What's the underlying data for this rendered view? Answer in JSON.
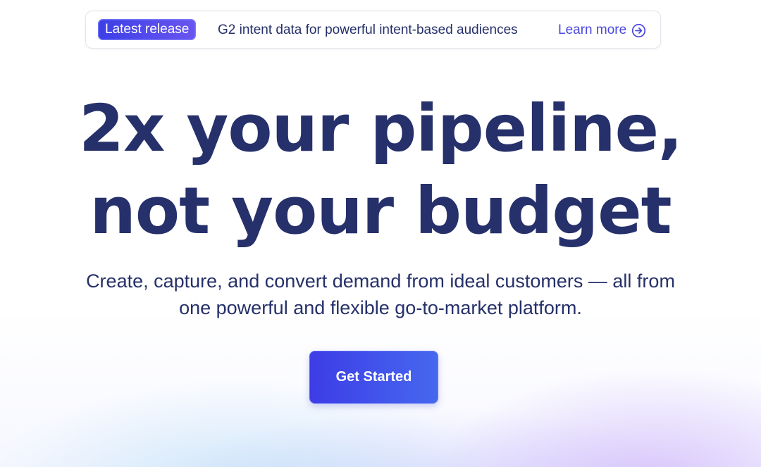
{
  "banner": {
    "badge_label": "Latest release",
    "message": "G2 intent data for powerful intent-based audiences",
    "link_label": "Learn more",
    "link_icon": "arrow-right-circle-icon"
  },
  "hero": {
    "headline_line1": "2x your pipeline,",
    "headline_line2": "not your budget",
    "subtitle_line1": "Create, capture, and convert demand from ideal customers — all from",
    "subtitle_line2": "one powerful and flexible go-to-market platform.",
    "cta_label": "Get Started"
  },
  "colors": {
    "text_primary": "#26306a",
    "accent": "#4a47e0",
    "cta_start": "#3d3ce6",
    "cta_end": "#4668ef"
  }
}
